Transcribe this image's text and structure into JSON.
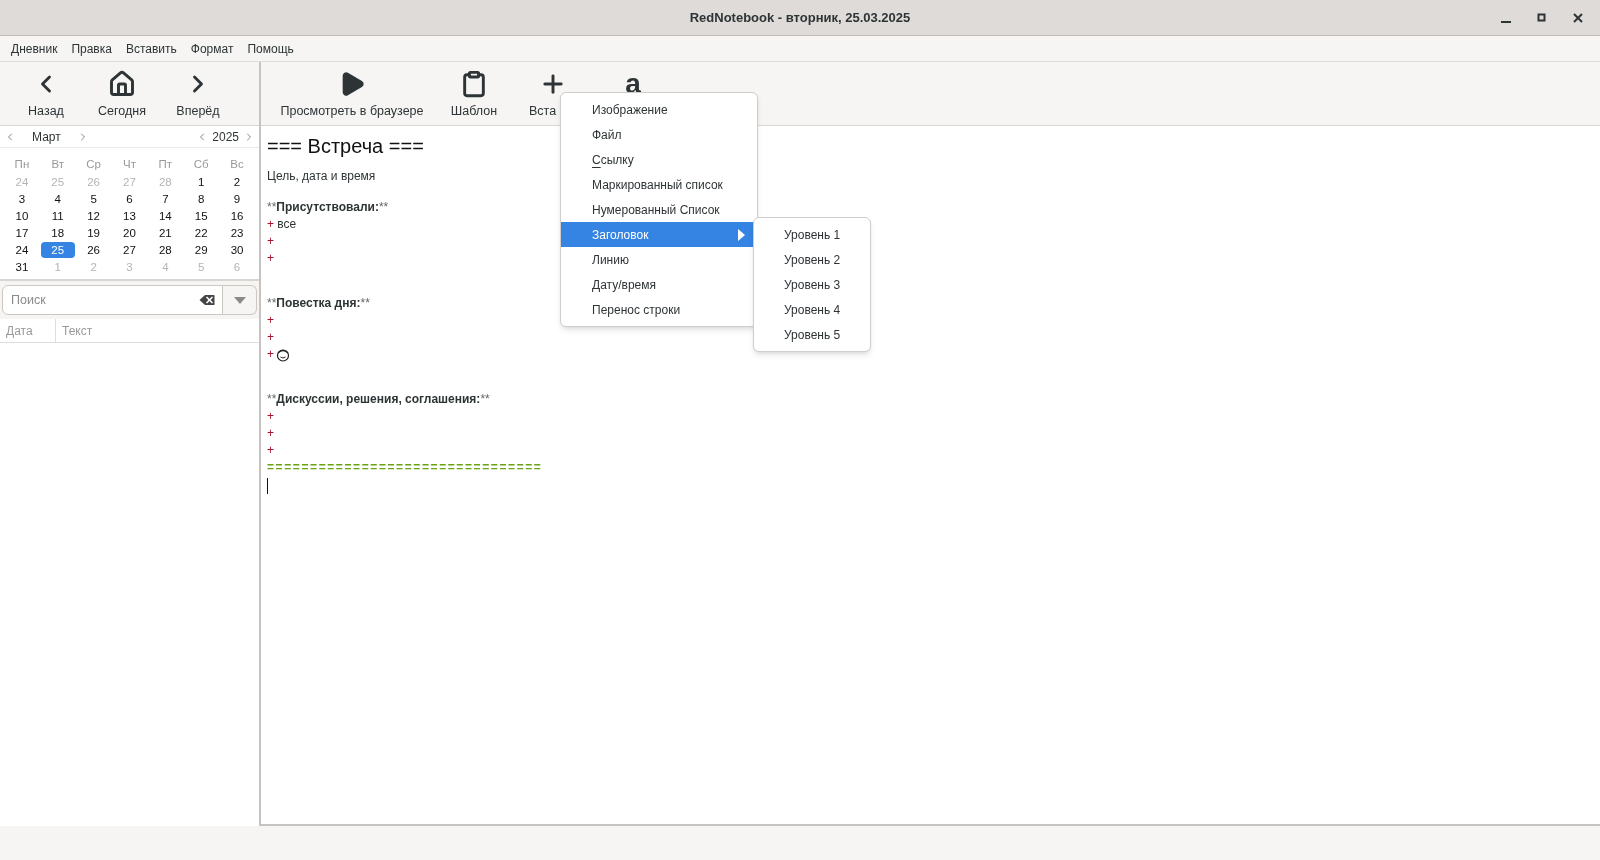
{
  "window": {
    "title": "RedNotebook - вторник, 25.03.2025"
  },
  "menubar": [
    "Дневник",
    "Правка",
    "Вставить",
    "Формат",
    "Помощь"
  ],
  "nav_toolbar": [
    {
      "label": "Назад"
    },
    {
      "label": "Сегодня"
    },
    {
      "label": "Вперёд"
    }
  ],
  "toolbar": [
    {
      "label": "Просмотреть в браузере"
    },
    {
      "label": "Шаблон"
    },
    {
      "label": "Вста"
    },
    {
      "glyph": "a"
    }
  ],
  "calendar": {
    "month": "Март",
    "year": "2025",
    "weekdays": [
      "Пн",
      "Вт",
      "Ср",
      "Чт",
      "Пт",
      "Сб",
      "Вс"
    ],
    "days": [
      {
        "day": "24",
        "dim": true,
        "selected": false
      },
      {
        "day": "25",
        "dim": true,
        "selected": false
      },
      {
        "day": "26",
        "dim": true,
        "selected": false
      },
      {
        "day": "27",
        "dim": true,
        "selected": false
      },
      {
        "day": "28",
        "dim": true,
        "selected": false
      },
      {
        "day": "1",
        "dim": false,
        "selected": false
      },
      {
        "day": "2",
        "dim": false,
        "selected": false
      },
      {
        "day": "3",
        "dim": false,
        "selected": false
      },
      {
        "day": "4",
        "dim": false,
        "selected": false
      },
      {
        "day": "5",
        "dim": false,
        "selected": false
      },
      {
        "day": "6",
        "dim": false,
        "selected": false
      },
      {
        "day": "7",
        "dim": false,
        "selected": false
      },
      {
        "day": "8",
        "dim": false,
        "selected": false
      },
      {
        "day": "9",
        "dim": false,
        "selected": false
      },
      {
        "day": "10",
        "dim": false,
        "selected": false
      },
      {
        "day": "11",
        "dim": false,
        "selected": false
      },
      {
        "day": "12",
        "dim": false,
        "selected": false
      },
      {
        "day": "13",
        "dim": false,
        "selected": false
      },
      {
        "day": "14",
        "dim": false,
        "selected": false
      },
      {
        "day": "15",
        "dim": false,
        "selected": false
      },
      {
        "day": "16",
        "dim": false,
        "selected": false
      },
      {
        "day": "17",
        "dim": false,
        "selected": false
      },
      {
        "day": "18",
        "dim": false,
        "selected": false
      },
      {
        "day": "19",
        "dim": false,
        "selected": false
      },
      {
        "day": "20",
        "dim": false,
        "selected": false
      },
      {
        "day": "21",
        "dim": false,
        "selected": false
      },
      {
        "day": "22",
        "dim": false,
        "selected": false
      },
      {
        "day": "23",
        "dim": false,
        "selected": false
      },
      {
        "day": "24",
        "dim": false,
        "selected": false
      },
      {
        "day": "25",
        "dim": false,
        "selected": true
      },
      {
        "day": "26",
        "dim": false,
        "selected": false
      },
      {
        "day": "27",
        "dim": false,
        "selected": false
      },
      {
        "day": "28",
        "dim": false,
        "selected": false
      },
      {
        "day": "29",
        "dim": false,
        "selected": false
      },
      {
        "day": "30",
        "dim": false,
        "selected": false
      },
      {
        "day": "31",
        "dim": false,
        "selected": false
      },
      {
        "day": "1",
        "dim": true,
        "selected": false
      },
      {
        "day": "2",
        "dim": true,
        "selected": false
      },
      {
        "day": "3",
        "dim": true,
        "selected": false
      },
      {
        "day": "4",
        "dim": true,
        "selected": false
      },
      {
        "day": "5",
        "dim": true,
        "selected": false
      },
      {
        "day": "6",
        "dim": true,
        "selected": false
      }
    ]
  },
  "search": {
    "placeholder": "Поиск"
  },
  "results_table": {
    "columns": [
      "Дата",
      "Текст"
    ]
  },
  "editor": {
    "lines": [
      {
        "kind": "heading",
        "text": "=== Встреча ==="
      },
      {
        "kind": "text",
        "text": "Цель, дата и время"
      },
      {
        "kind": "blank"
      },
      {
        "kind": "bold",
        "open": "**",
        "text": "Присутствовали:",
        "close": "**"
      },
      {
        "kind": "bullet",
        "marker": "+",
        "text": "все"
      },
      {
        "kind": "bullet",
        "marker": "+"
      },
      {
        "kind": "bullet",
        "marker": "+"
      },
      {
        "kind": "blank"
      },
      {
        "kind": "blank"
      },
      {
        "kind": "bold",
        "open": "**",
        "text": "Повестка дня:",
        "close": "**"
      },
      {
        "kind": "bullet",
        "marker": "+"
      },
      {
        "kind": "bullet",
        "marker": "+"
      },
      {
        "kind": "bullet",
        "marker": "+",
        "emoji": true
      },
      {
        "kind": "blank"
      },
      {
        "kind": "blank"
      },
      {
        "kind": "bold",
        "open": "**",
        "text": "Дискуссии, решения, соглашения:",
        "close": "**"
      },
      {
        "kind": "bullet",
        "marker": "+"
      },
      {
        "kind": "bullet",
        "marker": "+"
      },
      {
        "kind": "bullet",
        "marker": "+"
      },
      {
        "kind": "rule",
        "text": "================================"
      },
      {
        "kind": "cursor"
      }
    ]
  },
  "insert_menu": {
    "items": [
      {
        "label": "Изображение",
        "selected": false,
        "submenu": false,
        "mnemonic": false
      },
      {
        "label": "Файл",
        "selected": false,
        "submenu": false,
        "mnemonic": false
      },
      {
        "label": "Ссылку",
        "selected": false,
        "submenu": false,
        "mnemonic": true
      },
      {
        "label": "Маркированный список",
        "selected": false,
        "submenu": false,
        "mnemonic": false
      },
      {
        "label": "Нумерованный Список",
        "selected": false,
        "submenu": false,
        "mnemonic": false
      },
      {
        "label": "Заголовок",
        "selected": true,
        "submenu": true,
        "mnemonic": false
      },
      {
        "label": "Линию",
        "selected": false,
        "submenu": false,
        "mnemonic": false
      },
      {
        "label": "Дату/время",
        "selected": false,
        "submenu": false,
        "mnemonic": false
      },
      {
        "label": "Перенос строки",
        "selected": false,
        "submenu": false,
        "mnemonic": false
      }
    ],
    "submenu": [
      "Уровень 1",
      "Уровень 2",
      "Уровень 3",
      "Уровень 4",
      "Уровень 5"
    ]
  }
}
